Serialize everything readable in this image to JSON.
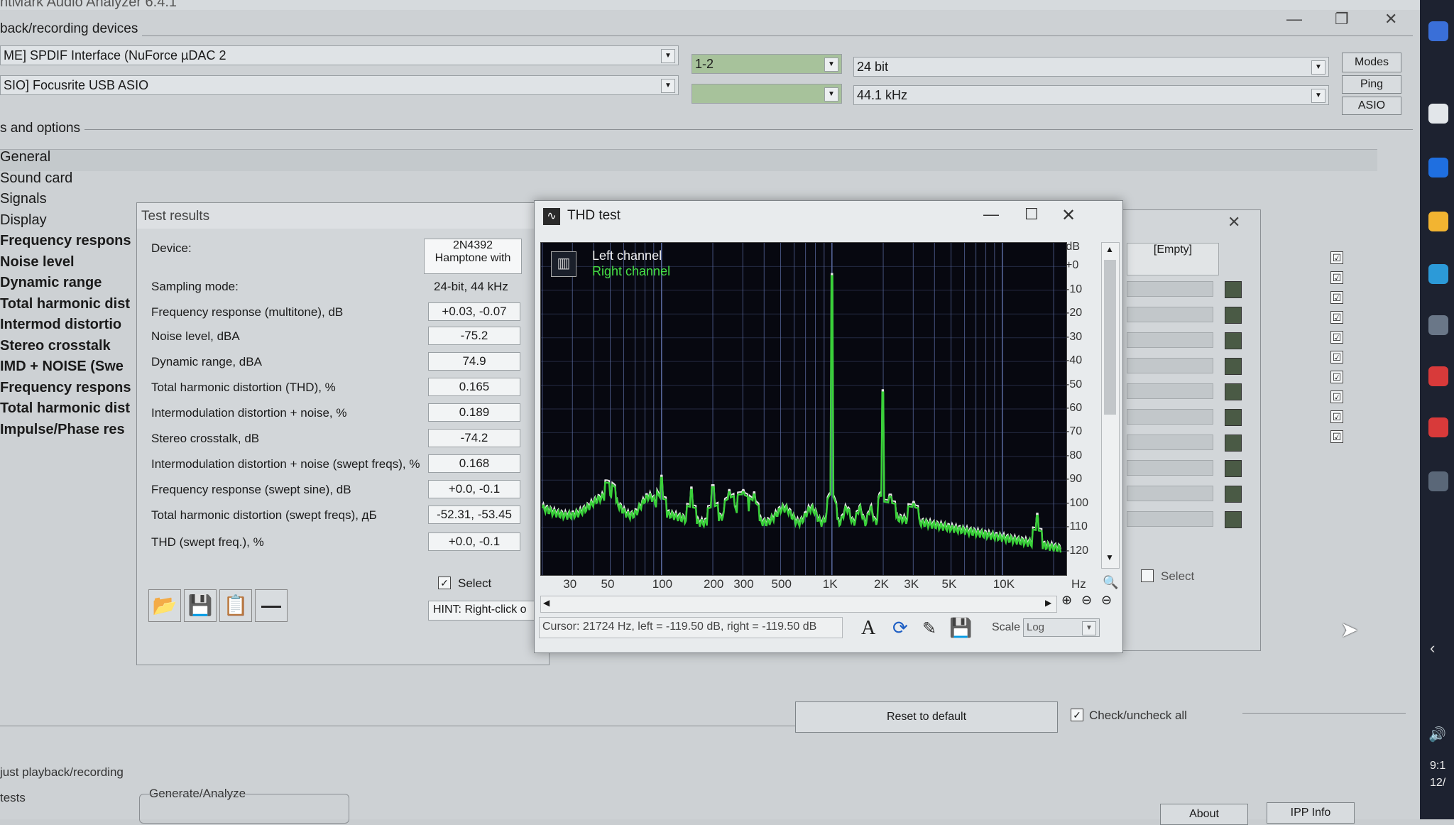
{
  "app": {
    "title": "ntMark Audio Analyzer 6.4.1",
    "controls": {
      "minimize": "—",
      "restore": "❐",
      "close": "✕"
    }
  },
  "devices": {
    "group_title": "back/recording devices",
    "playback": "ME] SPDIF Interface (NuForce µDAC 2",
    "recording": "SIO] Focusrite USB ASIO",
    "channels": "1-2",
    "channels2": "",
    "bit_depth": "24 bit",
    "sample_rate": "44.1 kHz",
    "buttons": {
      "modes": "Modes",
      "ping": "Ping",
      "asio": "ASIO"
    }
  },
  "options": {
    "group_title": "s and options",
    "list": [
      {
        "label": "General",
        "bold": false
      },
      {
        "label": "Sound card",
        "bold": false
      },
      {
        "label": "Signals",
        "bold": false
      },
      {
        "label": "Display",
        "bold": false
      },
      {
        "label": "Frequency respons",
        "bold": true
      },
      {
        "label": "Noise level",
        "bold": true
      },
      {
        "label": "Dynamic range",
        "bold": true
      },
      {
        "label": "Total harmonic dist",
        "bold": true
      },
      {
        "label": "Intermod distortio",
        "bold": true
      },
      {
        "label": "Stereo crosstalk",
        "bold": true
      },
      {
        "label": "IMD + NOISE (Swe",
        "bold": true
      },
      {
        "label": "Frequency respons",
        "bold": true
      },
      {
        "label": "Total harmonic dist",
        "bold": true
      },
      {
        "label": "Impulse/Phase res",
        "bold": true
      }
    ],
    "checkmarks": [
      "☑",
      "☑",
      "☑",
      "☑",
      "☑",
      "☑",
      "☑",
      "☑",
      "☑",
      "☑"
    ],
    "reset_button": "Reset to default",
    "check_all": "Check/uncheck all"
  },
  "test_results": {
    "title": "Test results",
    "device_label": "Device:",
    "device_value_1": "2N4392",
    "device_value_2": "Hamptone with",
    "sampling_label": "Sampling mode:",
    "sampling_value": "24-bit, 44 kHz",
    "rows": [
      {
        "label": "Frequency response (multitone), dB",
        "value": "+0.03, -0.07"
      },
      {
        "label": "Noise level, dBA",
        "value": "-75.2"
      },
      {
        "label": "Dynamic range, dBA",
        "value": "74.9"
      },
      {
        "label": "Total harmonic distortion (THD), %",
        "value": "0.165"
      },
      {
        "label": "Intermodulation distortion + noise, %",
        "value": "0.189"
      },
      {
        "label": "Stereo crosstalk, dB",
        "value": "-74.2"
      },
      {
        "label": "Intermodulation distortion + noise (swept freqs), %",
        "value": "0.168"
      },
      {
        "label": "Frequency response (swept sine), dB",
        "value": "+0.0, -0.1"
      },
      {
        "label": "Total harmonic distortion (swept freqs), дБ",
        "value": "-52.31, -53.45"
      },
      {
        "label": "THD (swept freq.), %",
        "value": "+0.0, -0.1"
      }
    ],
    "select_label": "Select",
    "hint": "HINT: Right-click o"
  },
  "right_panel": {
    "empty_label": "[Empty]",
    "select_label": "Select"
  },
  "thd": {
    "title": "THD test",
    "legend_left": "Left channel",
    "legend_right": "Right channel",
    "y_unit": "dB",
    "x_unit": "Hz",
    "y_ticks": [
      "+0",
      "-10",
      "-20",
      "-30",
      "-40",
      "-50",
      "-60",
      "-70",
      "-80",
      "-90",
      "-100",
      "-110",
      "-120"
    ],
    "x_ticks": [
      "30",
      "50",
      "100",
      "200",
      "300",
      "500",
      "1K",
      "2K",
      "3K",
      "5K",
      "10K"
    ],
    "cursor": "Cursor:  21724 Hz,  left = -119.50 dB,  right = -119.50 dB",
    "scale_label": "Scale",
    "scale_value": "Log",
    "colors": {
      "left": "#e8e8e8",
      "right": "#3ad13a",
      "bg": "#070810",
      "grid": "#5a6aa0"
    }
  },
  "bottom": {
    "adjust": "just playback/recording",
    "tests": "tests",
    "generate": "Generate/Analyze",
    "about": "About",
    "ipp": "IPP Info"
  },
  "taskbar": {
    "time": "9:1",
    "date": "12/"
  }
}
